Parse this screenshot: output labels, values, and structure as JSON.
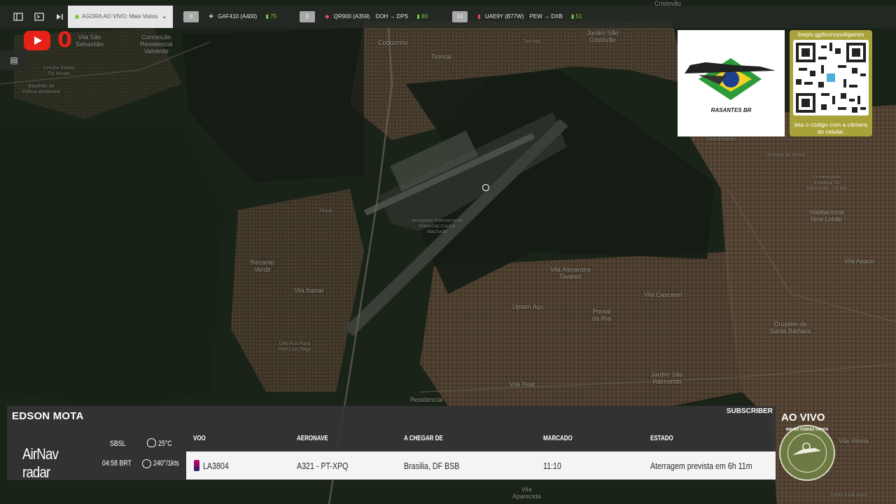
{
  "map_labels": {
    "sao_sebastiao": "Vila São\nSebastião",
    "conceicao": "Conceição\nResidencial\nValverde",
    "creche": "Creche Estela\nTia Nunan",
    "batalhao": "Batalhão de\nPolícia Ambiental",
    "codozinho": "Codozinho",
    "tirirical": "Tirirical",
    "jardim_sao_cristovao": "Jardim São\nCristóvão",
    "cristovao": "Cristovão",
    "tarcisio": "Tarcísio",
    "aeroporto": "Aeroporto Internacional\nMarechal Cunha\nMachado",
    "tirical": "Tirical",
    "recanto_verde": "Recanto\nVerde",
    "vila_itamar": "Vila Itamar",
    "ueb_luis_rego": "Ueb Ens Fund\nProf Luis Rego",
    "vila_alexandra": "Vila Alexandra\nTavares",
    "upaon": "Upaon Açu",
    "pontal": "Pontal\nda Ilha",
    "vila_cascavel": "Vila Cascavel",
    "cruzeiro": "Cruzeiro de\nSanta Bárbara",
    "habitacional": "Habitacional\nNice Lobão",
    "vila_apaco": "Vila Apaco",
    "jardim_raimundo": "Jardim São\nRaimundo",
    "vila_real": "Vila Real",
    "residencial": "Residencial",
    "vila_vitoria": "Vila Vitoria",
    "vila_aparecida": "Vila\nAparecida",
    "universidade": "Universidade\nEstadual do\nMaranhão - UEMA",
    "bosque": "Bosque da Uema",
    "dom_ricardo": "Dom Ricardo",
    "ponto_final": "Ponto Final A682"
  },
  "topbar": {
    "live_label": "AGORA AO VIVO: Mais Vistos",
    "flights": [
      {
        "num": "8",
        "callsign": "GAF410 (A400)",
        "route": "",
        "seats": "75"
      },
      {
        "num": "9",
        "callsign": "QR900 (A359)",
        "route": "DOH → DPS",
        "seats": "80"
      },
      {
        "num": "10",
        "callsign": "UAE9Y (B77W)",
        "route": "PEW → DXB",
        "seats": "51"
      }
    ]
  },
  "youtube": {
    "count": "0"
  },
  "logo": {
    "text": "RASANTES BR"
  },
  "qr": {
    "url": "liveplx.gg/brunoyudigames",
    "caption": "leia o código com a câmera do celular."
  },
  "panel": {
    "host": "EDSON MOTA",
    "subscriber": "SUBSCRIBER",
    "brand": "AirNav radar",
    "airport_code": "SBSL",
    "time": "04:58 BRT",
    "temperature": "25°C",
    "wind": "240°/1kts",
    "headers": {
      "flight": "VOO",
      "aircraft": "AERONAVE",
      "origin": "A CHEGAR DE",
      "scheduled": "MARCADO",
      "status": "ESTADO"
    },
    "row": {
      "flight": "LA3804",
      "aircraft": "A321 - PT-XPQ",
      "origin": "Brasilia, DF BSB",
      "scheduled": "11:10",
      "status": "Aterragem prevista em 6h 11m"
    }
  },
  "live_badge": {
    "label": "AO VIVO",
    "ring_text": "BRUNO YUDKEZ TARIOS"
  },
  "colors": {
    "accent_green": "#7ac943",
    "youtube_red": "#e62117",
    "qr_gold": "#a9a23a"
  }
}
